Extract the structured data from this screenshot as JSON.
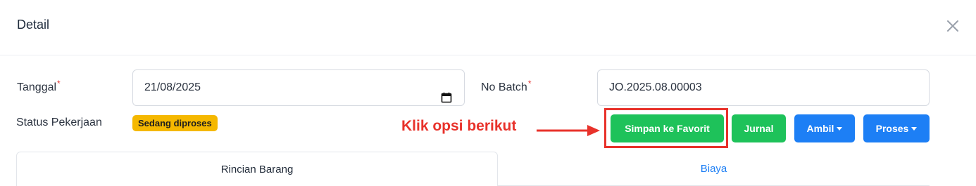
{
  "modal": {
    "title": "Detail"
  },
  "form": {
    "tanggal_label": "Tanggal",
    "required_mark": "*",
    "tanggal_value": "21/08/2025",
    "no_batch_label": "No Batch",
    "no_batch_value": "JO.2025.08.00003",
    "status_label": "Status Pekerjaan",
    "status_badge": "Sedang diproses"
  },
  "annotation": {
    "text": "Klik opsi berikut",
    "color": "#e8322b"
  },
  "actions": {
    "simpan_favorit": "Simpan ke Favorit",
    "jurnal": "Jurnal",
    "ambil": "Ambil",
    "proses": "Proses"
  },
  "tabs": [
    {
      "label": "Rincian Barang",
      "active": true
    },
    {
      "label": "Biaya",
      "active": false
    }
  ],
  "colors": {
    "green": "#1ec25a",
    "blue": "#1d7ff5",
    "badge": "#f5b800",
    "required": "#e53935"
  }
}
